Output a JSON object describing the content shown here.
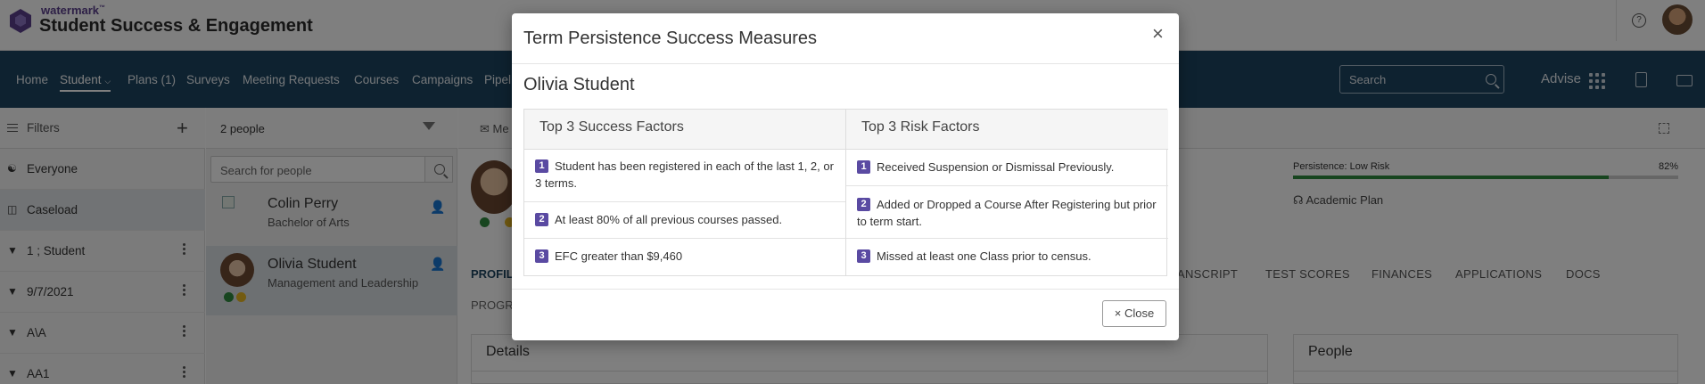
{
  "header": {
    "brand_small": "watermark",
    "brand_tm": "™",
    "app_title": "Student Success & Engagement",
    "help_glyph": "?"
  },
  "nav": {
    "items": [
      "Home",
      "Student",
      "Plans (1)",
      "Surveys",
      "Meeting Requests",
      "Courses",
      "Campaigns",
      "Pipel"
    ],
    "active": "Student",
    "search_placeholder": "Search",
    "advise_label": "Advise"
  },
  "filters": {
    "title": "Filters",
    "add_glyph": "+",
    "items": [
      {
        "label": "Everyone",
        "icon": "people-icon",
        "selected": false
      },
      {
        "label": "Caseload",
        "icon": "briefcase-icon",
        "selected": true
      },
      {
        "label": "1 ; Student",
        "icon": "funnel-icon",
        "selected": false
      },
      {
        "label": "9/7/2021",
        "icon": "funnel-icon",
        "selected": false
      },
      {
        "label": "A\\A",
        "icon": "funnel-icon",
        "selected": false
      },
      {
        "label": "AA1",
        "icon": "funnel-icon",
        "selected": false
      }
    ]
  },
  "people": {
    "count_label": "2 people",
    "search_placeholder": "Search for people",
    "list": [
      {
        "name": "Colin Perry",
        "program": "Bachelor of Arts"
      },
      {
        "name": "Olivia Student",
        "program": "Management and Leadership"
      }
    ]
  },
  "main": {
    "message_tab": "Me",
    "persistence_label": "Persistence: Low Risk",
    "persistence_pct_label": "82%",
    "persistence_value": 0.82,
    "academic_plan": "Academic Plan",
    "profile_tab": "PROFIL",
    "tabs": [
      "ANSCRIPT",
      "TEST SCORES",
      "FINANCES",
      "APPLICATIONS",
      "DOCS"
    ],
    "sub_tab": "PROGR",
    "cards": [
      "Details",
      "People"
    ]
  },
  "modal": {
    "title": "Term Persistence Success Measures",
    "close_x": "×",
    "student_name": "Olivia Student",
    "success_header": "Top 3 Success Factors",
    "risk_header": "Top 3 Risk Factors",
    "success_factors": [
      {
        "num": "1",
        "text": "Student has been registered in each of the last 1, 2, or 3 terms."
      },
      {
        "num": "2",
        "text": "At least 80% of all previous courses passed."
      },
      {
        "num": "3",
        "text": "EFC greater than $9,460"
      }
    ],
    "risk_factors": [
      {
        "num": "1",
        "text": "Received Suspension or Dismissal Previously."
      },
      {
        "num": "2",
        "text": "Added or Dropped a Course After Registering but prior to term start."
      },
      {
        "num": "3",
        "text": "Missed at least one Class prior to census."
      }
    ],
    "close_button": "× Close"
  },
  "colors": {
    "nav_bg": "#1d4460",
    "brand_purple": "#5a3e8c",
    "badge_purple": "#5a4aa2",
    "success_green": "#2e8b3e",
    "warning_yellow": "#e7b622"
  }
}
